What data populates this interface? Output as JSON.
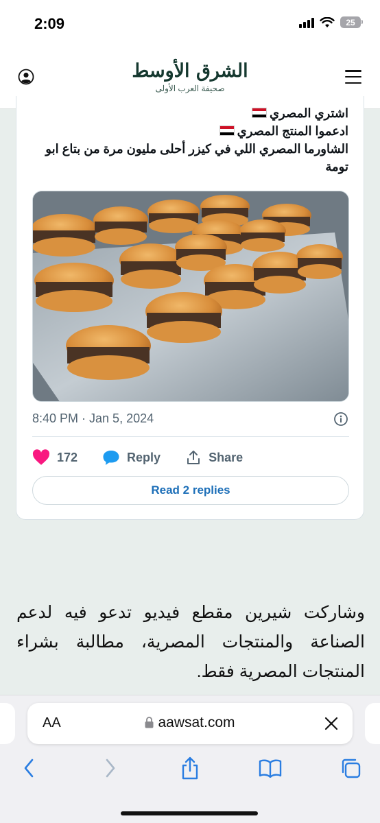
{
  "status_bar": {
    "time": "2:09",
    "battery": "25"
  },
  "header": {
    "logo_title": "الشرق الأوسط",
    "logo_subtitle": "صحيفة العرب الأولى",
    "account_icon": "user-circle-icon",
    "menu_icon": "hamburger-menu-icon"
  },
  "tweet": {
    "lines": [
      "اشتري المصري",
      "ادعموا المنتج المصري",
      "الشاورما المصري اللي في كيزر أحلى مليون مرة من بتاع ابو تومة"
    ],
    "flag_colors": [
      "#ce1126",
      "#ffffff",
      "#000000"
    ],
    "image_alt": "sandwiches-tray",
    "timestamp": "8:40 PM · Jan 5, 2024",
    "likes": "172",
    "reply_label": "Reply",
    "share_label": "Share",
    "read_replies_label": "Read 2 replies",
    "like_color": "#f91880",
    "reply_color": "#1d9bf0",
    "link_color": "#1d6fb8"
  },
  "article": {
    "paragraph": "وشاركت شيرين مقطع فيديو تدعو فيه لدعم الصناعة والمنتجات المصرية، مطالبة بشراء المنتجات المصرية فقط."
  },
  "browser": {
    "aa_label": "AA",
    "url": "aawsat.com",
    "toolbar_icons": [
      "back-icon",
      "forward-icon",
      "share-icon",
      "bookmarks-icon",
      "tabs-icon"
    ]
  }
}
